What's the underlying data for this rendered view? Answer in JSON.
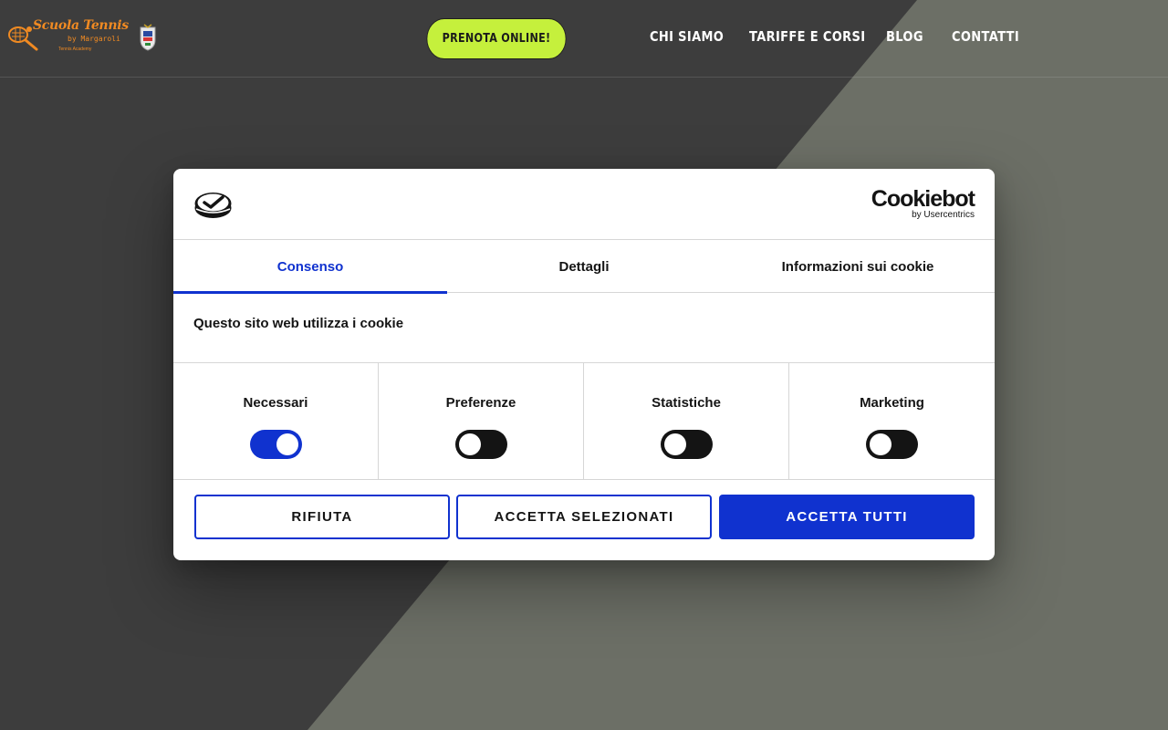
{
  "site": {
    "logo": {
      "title": "Scuola Tennis",
      "by": "by Margaroli",
      "tagline": "Tennis Academy"
    },
    "cta_label": "PRENOTA ONLINE!",
    "nav": [
      {
        "label": "CHI SIAMO"
      },
      {
        "label": "TARIFFE E CORSI"
      },
      {
        "label": "BLOG"
      },
      {
        "label": "CONTATTI"
      }
    ],
    "colors": {
      "cta_bg": "#c5f03c",
      "logo_orange": "#f08a22",
      "bg_dark": "#3d3d3d",
      "bg_olive": "#6c6f66"
    }
  },
  "cookie_dialog": {
    "brand": {
      "name": "Cookiebot",
      "by": "by Usercentrics",
      "icon": "cookiebot-check-icon"
    },
    "tabs": [
      {
        "label": "Consenso",
        "active": true
      },
      {
        "label": "Dettagli",
        "active": false
      },
      {
        "label": "Informazioni sui cookie",
        "active": false
      }
    ],
    "intro_title": "Questo sito web utilizza i cookie",
    "categories": [
      {
        "label": "Necessari",
        "enabled": true
      },
      {
        "label": "Preferenze",
        "enabled": false
      },
      {
        "label": "Statistiche",
        "enabled": false
      },
      {
        "label": "Marketing",
        "enabled": false
      }
    ],
    "buttons": {
      "reject": "RIFIUTA",
      "accept_selected": "ACCETTA SELEZIONATI",
      "accept_all": "ACCETTA TUTTI"
    },
    "colors": {
      "accent": "#1032cf",
      "text": "#141414",
      "border": "#d6d6d6"
    }
  }
}
